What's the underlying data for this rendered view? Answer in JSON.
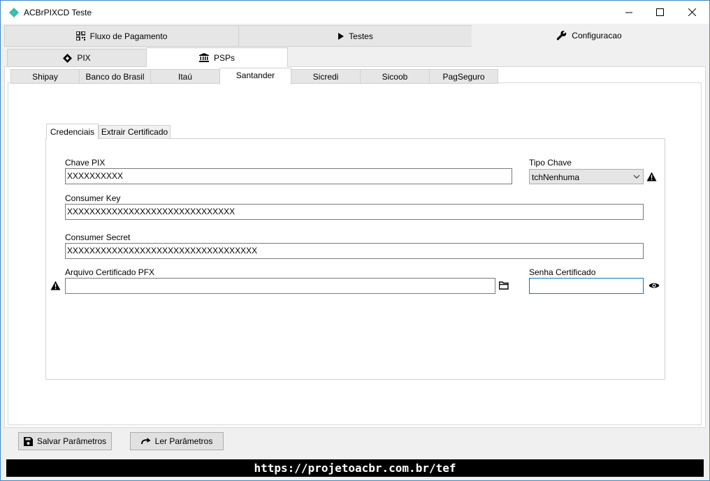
{
  "window": {
    "title": "ACBrPIXCD Teste"
  },
  "main_tabs": [
    {
      "label": "Fluxo de Pagamento",
      "icon": "qrcode-icon"
    },
    {
      "label": "Testes",
      "icon": "play-icon"
    },
    {
      "label": "Configuracao",
      "icon": "wrench-icon",
      "active": true
    }
  ],
  "sub_tabs": [
    {
      "label": "PIX",
      "icon": "pix-icon"
    },
    {
      "label": "PSPs",
      "icon": "bank-icon",
      "active": true
    }
  ],
  "psp_tabs": [
    "Shipay",
    "Banco do Brasil",
    "Itaú",
    "Santander",
    "Sicredi",
    "Sicoob",
    "PagSeguro"
  ],
  "psp_active": "Santander",
  "inner_tabs": [
    "Credenciais",
    "Extrair Certificado"
  ],
  "form": {
    "chave_pix_label": "Chave PIX",
    "chave_pix_value": "XXXXXXXXXX",
    "tipo_chave_label": "Tipo Chave",
    "tipo_chave_value": "tchNenhuma",
    "consumer_key_label": "Consumer Key",
    "consumer_key_value": "XXXXXXXXXXXXXXXXXXXXXXXXXXXXXX",
    "consumer_secret_label": "Consumer Secret",
    "consumer_secret_value": "XXXXXXXXXXXXXXXXXXXXXXXXXXXXXXXXXX",
    "arquivo_pfx_label": "Arquivo Certificado PFX",
    "arquivo_pfx_value": "",
    "senha_cert_label": "Senha Certificado",
    "senha_cert_value": ""
  },
  "buttons": {
    "salvar": "Salvar Parâmetros",
    "ler": "Ler Parâmetros"
  },
  "status": {
    "url": "https://projetoacbr.com.br/tef"
  },
  "colors": {
    "accent": "#0078d7",
    "pix": "#32bcad"
  }
}
